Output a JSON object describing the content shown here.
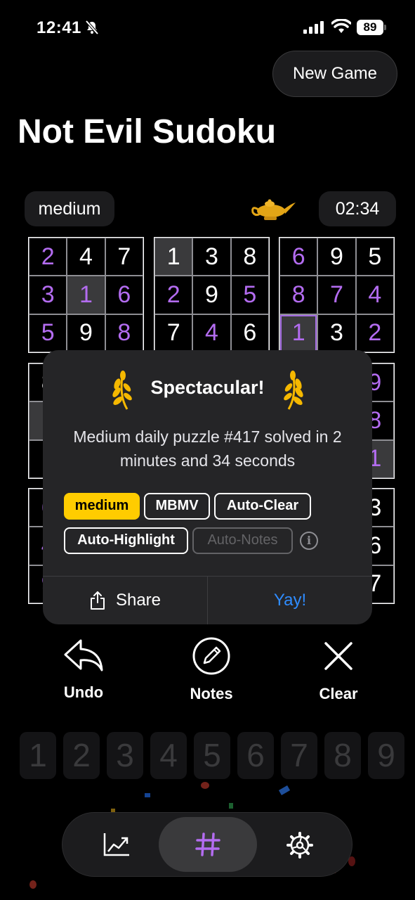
{
  "status_bar": {
    "time": "12:41",
    "battery": "89"
  },
  "header": {
    "new_game_label": "New Game",
    "title": "Not Evil Sudoku"
  },
  "game": {
    "difficulty": "medium",
    "timer": "02:34"
  },
  "board": [
    [
      {
        "v": "2",
        "p": true
      },
      {
        "v": "4"
      },
      {
        "v": "7"
      },
      {
        "v": "1",
        "hl": true
      },
      {
        "v": "3"
      },
      {
        "v": "8"
      },
      {
        "v": "6",
        "p": true
      },
      {
        "v": "9"
      },
      {
        "v": "5"
      }
    ],
    [
      {
        "v": "3",
        "p": true
      },
      {
        "v": "1",
        "p": true,
        "hl": true
      },
      {
        "v": "6",
        "p": true
      },
      {
        "v": "2",
        "p": true
      },
      {
        "v": "9"
      },
      {
        "v": "5",
        "p": true
      },
      {
        "v": "8",
        "p": true
      },
      {
        "v": "7",
        "p": true
      },
      {
        "v": "4",
        "p": true
      }
    ],
    [
      {
        "v": "5",
        "p": true
      },
      {
        "v": "9"
      },
      {
        "v": "8",
        "p": true
      },
      {
        "v": "7"
      },
      {
        "v": "4",
        "p": true
      },
      {
        "v": "6"
      },
      {
        "v": "1",
        "p": true,
        "sel": true
      },
      {
        "v": "3"
      },
      {
        "v": "2",
        "p": true
      }
    ],
    [
      {
        "v": "8"
      },
      {
        "v": ""
      },
      {
        "v": ""
      },
      {
        "v": ""
      },
      {
        "v": ""
      },
      {
        "v": ""
      },
      {
        "v": ""
      },
      {
        "v": ""
      },
      {
        "v": "9",
        "p": true
      }
    ],
    [
      {
        "v": "",
        "hl": true
      },
      {
        "v": ""
      },
      {
        "v": ""
      },
      {
        "v": ""
      },
      {
        "v": ""
      },
      {
        "v": ""
      },
      {
        "v": ""
      },
      {
        "v": ""
      },
      {
        "v": "8",
        "p": true
      }
    ],
    [
      {
        "v": "1"
      },
      {
        "v": ""
      },
      {
        "v": ""
      },
      {
        "v": ""
      },
      {
        "v": ""
      },
      {
        "v": ""
      },
      {
        "v": ""
      },
      {
        "v": ""
      },
      {
        "v": "1",
        "p": true,
        "hl": true
      }
    ],
    [
      {
        "v": "6",
        "p": true
      },
      {
        "v": ""
      },
      {
        "v": ""
      },
      {
        "v": ""
      },
      {
        "v": ""
      },
      {
        "v": ""
      },
      {
        "v": ""
      },
      {
        "v": ""
      },
      {
        "v": "3"
      }
    ],
    [
      {
        "v": "4",
        "p": true
      },
      {
        "v": ""
      },
      {
        "v": ""
      },
      {
        "v": ""
      },
      {
        "v": ""
      },
      {
        "v": ""
      },
      {
        "v": ""
      },
      {
        "v": ""
      },
      {
        "v": "6"
      }
    ],
    [
      {
        "v": "9",
        "p": true
      },
      {
        "v": ""
      },
      {
        "v": ""
      },
      {
        "v": ""
      },
      {
        "v": ""
      },
      {
        "v": ""
      },
      {
        "v": ""
      },
      {
        "v": ""
      },
      {
        "v": "7"
      }
    ]
  ],
  "dialog": {
    "title": "Spectacular!",
    "message": "Medium daily puzzle #417 solved in 2 minutes and 34 seconds",
    "tags": {
      "medium": "medium",
      "mbmv": "MBMV",
      "auto_clear": "Auto-Clear",
      "auto_highlight": "Auto-Highlight",
      "auto_notes": "Auto-Notes"
    },
    "share_label": "Share",
    "confirm_label": "Yay!"
  },
  "tools": {
    "undo": "Undo",
    "notes": "Notes",
    "clear": "Clear"
  },
  "numpad": [
    "1",
    "2",
    "3",
    "4",
    "5",
    "6",
    "7",
    "8",
    "9"
  ],
  "colors": {
    "accent_purple": "#b36cf0",
    "gold": "#ffcc00",
    "link_blue": "#2f8cff"
  },
  "tabs": {
    "icons": [
      "chart-icon",
      "grid-hash-icon",
      "settings-gear-icon"
    ],
    "active": "grid-hash-icon"
  }
}
